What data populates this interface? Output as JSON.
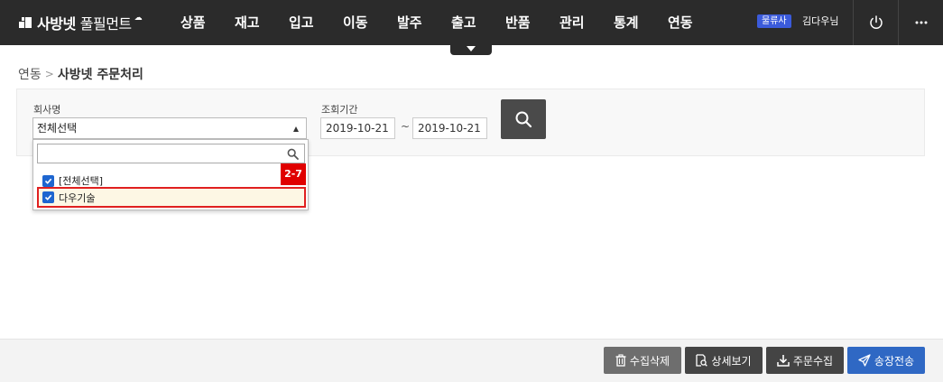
{
  "header": {
    "logo_text": "사방넷",
    "logo_text_light": "풀필먼트",
    "menu": [
      "상품",
      "재고",
      "입고",
      "이동",
      "발주",
      "출고",
      "반품",
      "관리",
      "통계",
      "연동"
    ],
    "role_badge": "물류사",
    "user_name": "김다우님"
  },
  "breadcrumb": {
    "home": "연동",
    "separator": ">",
    "current": "사방넷 주문처리"
  },
  "search": {
    "company_label": "회사명",
    "company_value": "전체선택",
    "period_label": "조회기간",
    "date_from": "2019-10-21",
    "date_to": "2019-10-21",
    "tilde": "~"
  },
  "dropdown": {
    "search_value": "",
    "options": [
      {
        "label": "[전체선택]",
        "checked": true
      },
      {
        "label": "다우기술",
        "checked": true
      }
    ],
    "step_badge": "2-7"
  },
  "actions": {
    "delete_label": "수집삭제",
    "detail_label": "상세보기",
    "collect_label": "주문수집",
    "send_label": "송장전송"
  },
  "colors": {
    "nav_bg": "#2b2b2b",
    "badge_blue": "#3b5bdb",
    "gray_btn": "#6e6e6e",
    "dark_btn": "#444444",
    "send_btn": "#2f68c4",
    "highlight_red": "#e02020"
  }
}
